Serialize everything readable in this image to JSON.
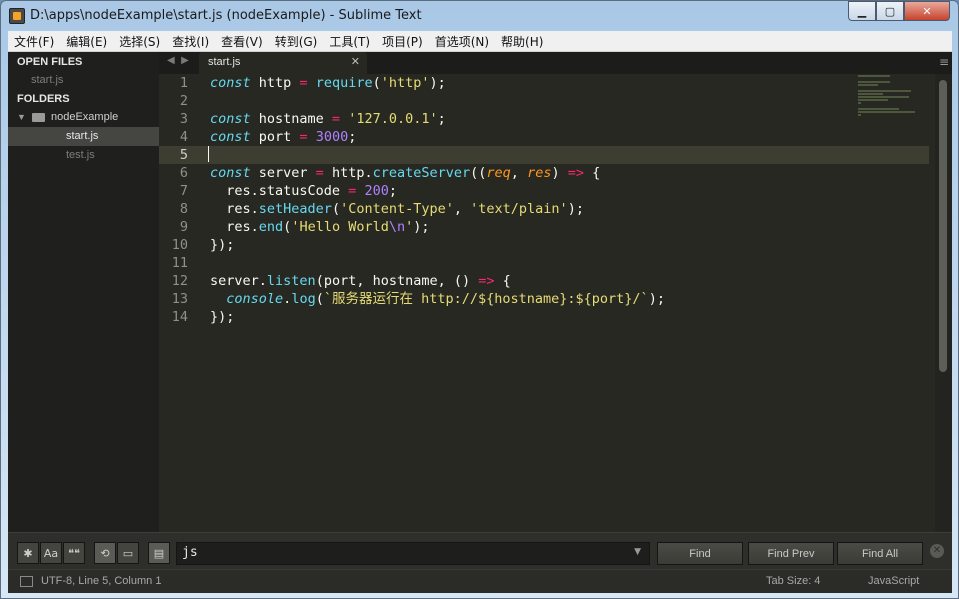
{
  "window": {
    "title": "D:\\apps\\nodeExample\\start.js (nodeExample) - Sublime Text",
    "controls": {
      "minimize": "▁",
      "maximize": "▢",
      "close": "✕"
    }
  },
  "menu": [
    "文件(F)",
    "编辑(E)",
    "选择(S)",
    "查找(I)",
    "查看(V)",
    "转到(G)",
    "工具(T)",
    "项目(P)",
    "首选项(N)",
    "帮助(H)"
  ],
  "sidebar": {
    "open_files_heading": "OPEN FILES",
    "open_files": [
      "start.js"
    ],
    "folders_heading": "FOLDERS",
    "folder_name": "nodeExample",
    "folder_files": [
      "start.js",
      "test.js"
    ],
    "active_file": "start.js"
  },
  "tabs": {
    "nav_left": "◀",
    "nav_right": "▶",
    "active_tab": "start.js",
    "close": "✕",
    "menu": "≡"
  },
  "editor": {
    "line_numbers": [
      "1",
      "2",
      "3",
      "4",
      "5",
      "6",
      "7",
      "8",
      "9",
      "10",
      "11",
      "12",
      "13",
      "14"
    ],
    "current_line": 5,
    "lines": [
      [
        [
          "kw",
          "const"
        ],
        [
          "pl",
          " http "
        ],
        [
          "op",
          "="
        ],
        [
          "pl",
          " "
        ],
        [
          "fn",
          "require"
        ],
        [
          "pl",
          "("
        ],
        [
          "str",
          "'http'"
        ],
        [
          "pl",
          ");"
        ]
      ],
      [],
      [
        [
          "kw",
          "const"
        ],
        [
          "pl",
          " hostname "
        ],
        [
          "op",
          "="
        ],
        [
          "pl",
          " "
        ],
        [
          "str",
          "'127.0.0.1'"
        ],
        [
          "pl",
          ";"
        ]
      ],
      [
        [
          "kw",
          "const"
        ],
        [
          "pl",
          " port "
        ],
        [
          "op",
          "="
        ],
        [
          "pl",
          " "
        ],
        [
          "num",
          "3000"
        ],
        [
          "pl",
          ";"
        ]
      ],
      [],
      [
        [
          "kw",
          "const"
        ],
        [
          "pl",
          " server "
        ],
        [
          "op",
          "="
        ],
        [
          "pl",
          " http."
        ],
        [
          "fn",
          "createServer"
        ],
        [
          "pl",
          "(("
        ],
        [
          "par",
          "req"
        ],
        [
          "pl",
          ", "
        ],
        [
          "par",
          "res"
        ],
        [
          "pl",
          ") "
        ],
        [
          "op",
          "=>"
        ],
        [
          "pl",
          " {"
        ]
      ],
      [
        [
          "pl",
          "  res.statusCode "
        ],
        [
          "op",
          "="
        ],
        [
          "pl",
          " "
        ],
        [
          "num",
          "200"
        ],
        [
          "pl",
          ";"
        ]
      ],
      [
        [
          "pl",
          "  res."
        ],
        [
          "fn",
          "setHeader"
        ],
        [
          "pl",
          "("
        ],
        [
          "str",
          "'Content-Type'"
        ],
        [
          "pl",
          ", "
        ],
        [
          "str",
          "'text/plain'"
        ],
        [
          "pl",
          ");"
        ]
      ],
      [
        [
          "pl",
          "  res."
        ],
        [
          "fn",
          "end"
        ],
        [
          "pl",
          "("
        ],
        [
          "str",
          "'Hello World"
        ],
        [
          "num",
          "\\n"
        ],
        [
          "str",
          "'"
        ],
        [
          "pl",
          ");"
        ]
      ],
      [
        [
          "pl",
          "});"
        ]
      ],
      [],
      [
        [
          "pl",
          "server."
        ],
        [
          "fn",
          "listen"
        ],
        [
          "pl",
          "(port, hostname, () "
        ],
        [
          "op",
          "=>"
        ],
        [
          "pl",
          " {"
        ]
      ],
      [
        [
          "pl",
          "  "
        ],
        [
          "kw",
          "console"
        ],
        [
          "pl",
          "."
        ],
        [
          "fn",
          "log"
        ],
        [
          "pl",
          "("
        ],
        [
          "str",
          "`服务器运行在 http://${hostname}:${port}/`"
        ],
        [
          "pl",
          ");"
        ]
      ],
      [
        [
          "pl",
          "});"
        ]
      ]
    ]
  },
  "find": {
    "regex_label": "✱",
    "case_label": "Aa",
    "word_label": "❝❝",
    "wrap_label": "⟲",
    "selection_label": "▭",
    "highlight_label": "▤",
    "query": "js",
    "find_button": "Find",
    "find_prev_button": "Find Prev",
    "find_all_button": "Find All",
    "close": "✕"
  },
  "status": {
    "encoding_position": "UTF-8, Line 5, Column 1",
    "tab_size": "Tab Size: 4",
    "syntax": "JavaScript"
  }
}
